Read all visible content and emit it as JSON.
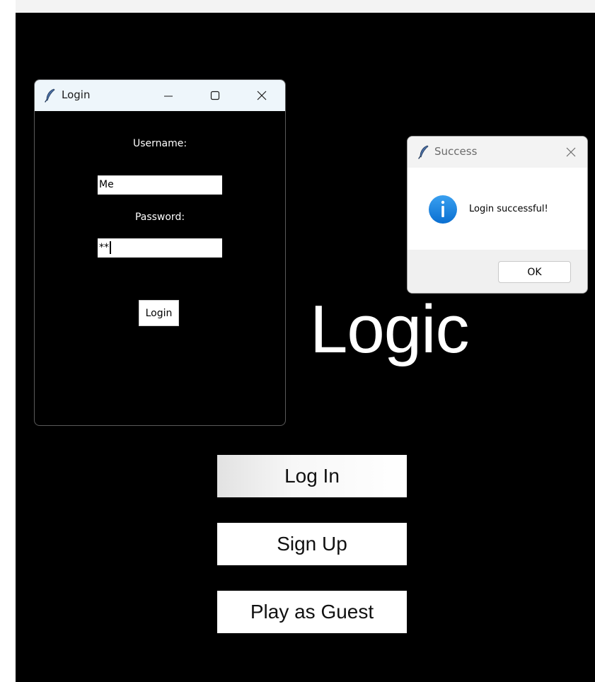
{
  "main": {
    "title": "Logic",
    "buttons": {
      "login": "Log In",
      "signup": "Sign Up",
      "guest": "Play as Guest"
    }
  },
  "login_window": {
    "title": "Login",
    "username_label": "Username:",
    "username_value": "Me",
    "password_label": "Password:",
    "password_value": "**",
    "submit_label": "Login",
    "icons": {
      "app": "feather-icon",
      "minimize": "minimize-icon",
      "maximize": "maximize-icon",
      "close": "close-icon"
    }
  },
  "dialog": {
    "title": "Success",
    "message": "Login successful!",
    "ok_label": "OK",
    "icons": {
      "app": "feather-icon",
      "info": "info-icon",
      "close": "close-icon"
    }
  },
  "colors": {
    "background": "#000000",
    "info_blue": "#1e88e5",
    "titlebar_active": "#eef6fb"
  }
}
